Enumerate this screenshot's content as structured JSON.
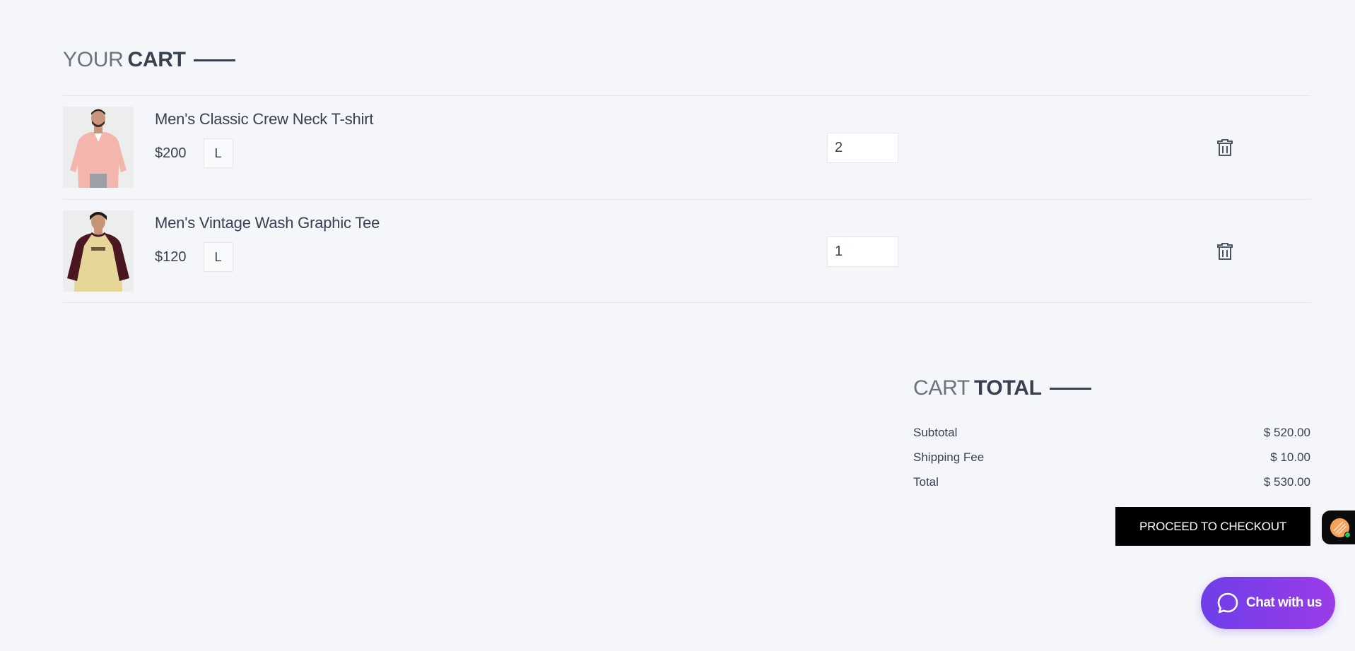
{
  "cart_section": {
    "title_light": "YOUR",
    "title_bold": "CART"
  },
  "cart_items": [
    {
      "name": "Men's Classic Crew Neck T-shirt",
      "price": "$200",
      "size": "L",
      "quantity": "2",
      "shirt_color": "#f4b5ac"
    },
    {
      "name": "Men's Vintage Wash Graphic Tee",
      "price": "$120",
      "size": "L",
      "quantity": "1",
      "shirt_color": "#e6d798"
    }
  ],
  "totals": {
    "title_light": "CART",
    "title_bold": "TOTAL",
    "subtotal_label": "Subtotal",
    "subtotal_value": "$ 520.00",
    "shipping_label": "Shipping Fee",
    "shipping_value": "$ 10.00",
    "total_label": "Total",
    "total_value": "$ 530.00",
    "checkout_label": "PROCEED TO CHECKOUT"
  },
  "chat": {
    "label": "Chat with us",
    "gradient_start": "#6d3fe8",
    "gradient_end": "#9b3be9"
  },
  "icons": {
    "delete": "trash-icon",
    "chat": "chat-bubble-icon"
  }
}
